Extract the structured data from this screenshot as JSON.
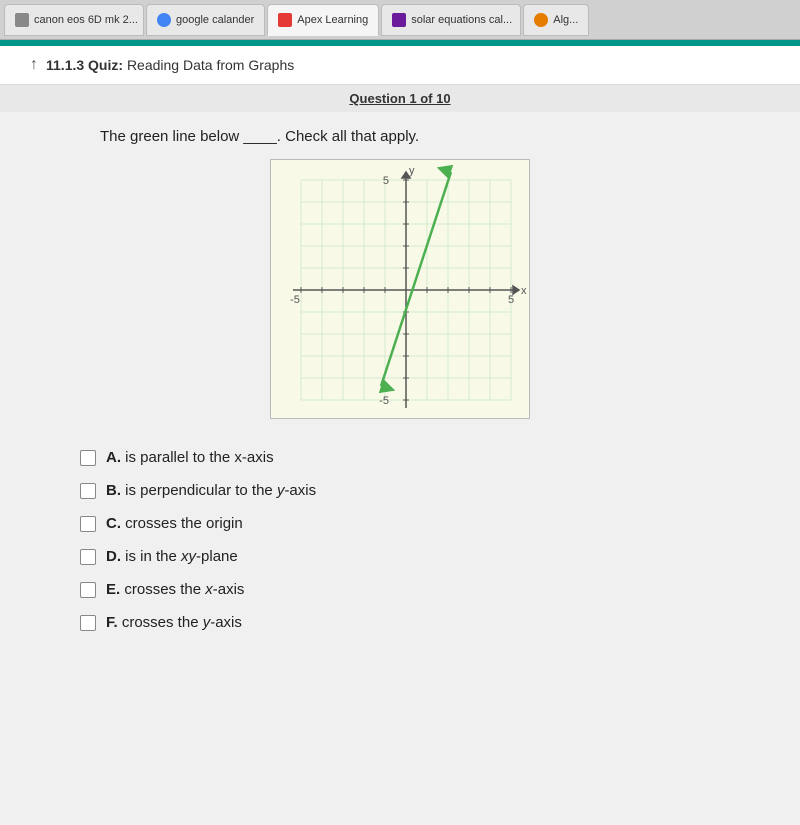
{
  "tabs": [
    {
      "id": "tab-canon",
      "label": "canon eos 6D mk 2...",
      "favicon_color": "#888",
      "active": false
    },
    {
      "id": "tab-google-cal",
      "label": "google calander",
      "favicon_color": "#4285F4",
      "active": false
    },
    {
      "id": "tab-apex",
      "label": "Apex Learning",
      "favicon_color": "#e53935",
      "active": true
    },
    {
      "id": "tab-solar",
      "label": "solar equations cal...",
      "favicon_color": "#6a1a9a",
      "active": false
    },
    {
      "id": "tab-alg",
      "label": "Alg...",
      "favicon_color": "#e57c00",
      "active": false
    }
  ],
  "quiz_header": {
    "arrow_icon": "↑",
    "section_label": "11.1.3 Quiz:",
    "section_title": "Reading Data from Graphs"
  },
  "question": {
    "number_text": "Question 1 of 10",
    "prompt": "The green line below ____. Check all that apply."
  },
  "graph": {
    "x_label": "x",
    "y_label": "y",
    "axis_min": -5,
    "axis_max": 5,
    "line": {
      "x1_data": -1,
      "y1_data": -4,
      "x2_data": 2,
      "y2_data": 5
    },
    "tick_labels": {
      "left": "-5",
      "right": "5",
      "bottom": "-5"
    }
  },
  "choices": [
    {
      "id": "choice-a",
      "letter": "A",
      "text": "is parallel to the x-axis",
      "checked": false
    },
    {
      "id": "choice-b",
      "letter": "B",
      "text": "is perpendicular to the y-axis",
      "checked": false
    },
    {
      "id": "choice-c",
      "letter": "C",
      "text": "crosses the origin",
      "checked": false
    },
    {
      "id": "choice-d",
      "letter": "D",
      "text": "is in the xy-plane",
      "checked": false
    },
    {
      "id": "choice-e",
      "letter": "E",
      "text": "crosses the x-axis",
      "checked": false
    },
    {
      "id": "choice-f",
      "letter": "F",
      "text": "crosses the y-axis",
      "checked": false
    }
  ]
}
